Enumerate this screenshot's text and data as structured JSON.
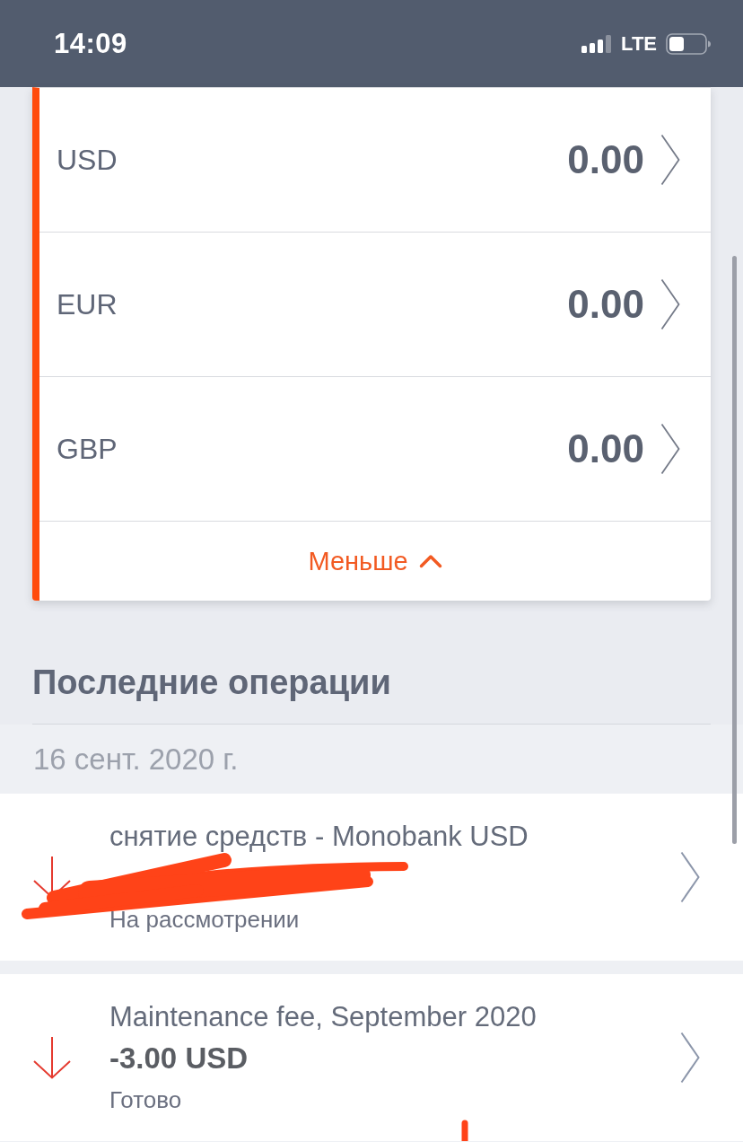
{
  "status_bar": {
    "time": "14:09",
    "network": "LTE"
  },
  "accounts": {
    "rows": [
      {
        "currency": "USD",
        "balance": "0.00"
      },
      {
        "currency": "EUR",
        "balance": "0.00"
      },
      {
        "currency": "GBP",
        "balance": "0.00"
      }
    ],
    "toggle": {
      "label": "Меньше",
      "expanded": true
    }
  },
  "recent": {
    "title": "Последние операции",
    "date": "16 сент. 2020 г.",
    "transactions": [
      {
        "kind": "debit",
        "title": "снятие средств - Monobank USD",
        "status": "На рассмотрении",
        "redacted": true
      },
      {
        "kind": "debit",
        "title": "Maintenance fee, September 2020",
        "amount": "-3.00 USD",
        "status": "Готово",
        "redacted": false
      }
    ]
  }
}
